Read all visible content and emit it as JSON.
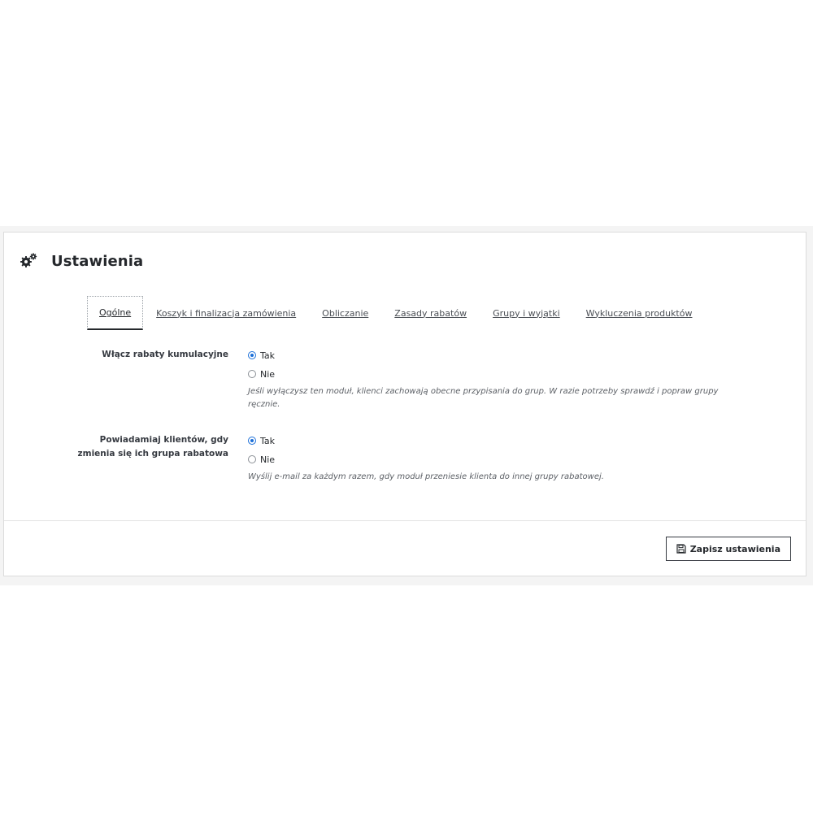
{
  "panel": {
    "title": "Ustawienia",
    "icon": "gears-icon"
  },
  "tabs": [
    {
      "label": "Ogólne",
      "active": true
    },
    {
      "label": "Koszyk i finalizacja zamówienia",
      "active": false
    },
    {
      "label": "Obliczanie",
      "active": false
    },
    {
      "label": "Zasady rabatów",
      "active": false
    },
    {
      "label": "Grupy i wyjątki",
      "active": false
    },
    {
      "label": "Wykluczenia produktów",
      "active": false
    }
  ],
  "fields": {
    "cumulative": {
      "label": "Włącz rabaty kumulacyjne",
      "options": {
        "yes": "Tak",
        "no": "Nie"
      },
      "selected": "Tak",
      "help": "Jeśli wyłączysz ten moduł, klienci zachowają obecne przypisania do grup. W razie potrzeby sprawdź i popraw grupy ręcznie."
    },
    "notify": {
      "label_line1": "Powiadamiaj klientów, gdy",
      "label_line2": "zmienia się ich grupa rabatowa",
      "options": {
        "yes": "Tak",
        "no": "Nie"
      },
      "selected": "Tak",
      "help": "Wyślij e-mail za każdym razem, gdy moduł przeniesie klienta do innej grupy rabatowej."
    }
  },
  "footer": {
    "save_label": "Zapisz ustawienia",
    "save_icon": "floppy-disk-icon"
  },
  "colors": {
    "accent": "#1a6ed8",
    "text": "#25282c"
  }
}
